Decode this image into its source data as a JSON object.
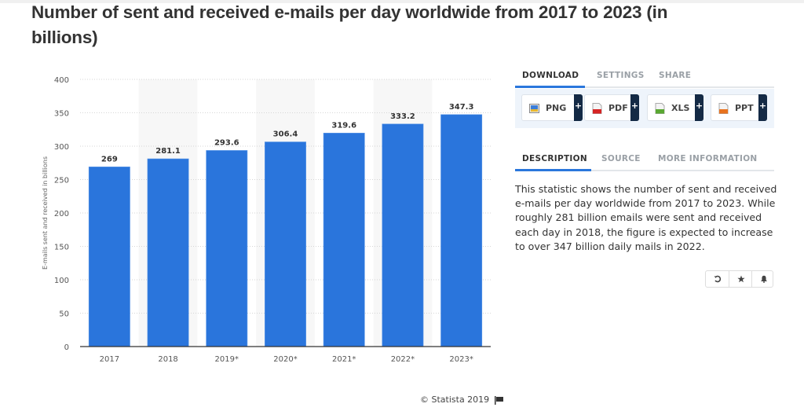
{
  "page": {
    "title": "Number of sent and received e-mails per day worldwide from 2017 to 2023 (in billions)",
    "credit": "© Statista 2019"
  },
  "panel": {
    "tabs_top": [
      {
        "label": "DOWNLOAD",
        "active": true
      },
      {
        "label": "SETTINGS",
        "active": false
      },
      {
        "label": "SHARE",
        "active": false
      }
    ],
    "downloads": [
      {
        "label": "PNG",
        "icon": "png-file-icon",
        "color": "#3b7dd8"
      },
      {
        "label": "PDF",
        "icon": "pdf-file-icon",
        "color": "#d62424"
      },
      {
        "label": "XLS",
        "icon": "xls-file-icon",
        "color": "#5aa832"
      },
      {
        "label": "PPT",
        "icon": "ppt-file-icon",
        "color": "#e8731f"
      }
    ],
    "plus_label": "+",
    "tabs_bottom": [
      {
        "label": "DESCRIPTION",
        "active": true
      },
      {
        "label": "SOURCE",
        "active": false
      },
      {
        "label": "MORE INFORMATION",
        "active": false
      }
    ],
    "description": "This statistic shows the number of sent and received e-mails per day worldwide from 2017 to 2023. While roughly 281 billion emails were sent and received each day in 2018, the figure is expected to increase to over 347 billion daily mails in 2022.",
    "actions": [
      "history-icon",
      "star-icon",
      "bell-icon"
    ]
  },
  "colors": {
    "bar": "#2a75dc",
    "accent": "#2a77dc",
    "band": "#f7f7f7"
  },
  "chart_data": {
    "type": "bar",
    "title": "Number of sent and received e-mails per day worldwide from 2017 to 2023 (in billions)",
    "xlabel": "",
    "ylabel": "E-mails sent and received in billions",
    "categories": [
      "2017",
      "2018",
      "2019*",
      "2020*",
      "2021*",
      "2022*",
      "2023*"
    ],
    "values": [
      269,
      281.1,
      293.6,
      306.4,
      319.6,
      333.2,
      347.3
    ],
    "data_labels": [
      "269",
      "281.1",
      "293.6",
      "306.4",
      "319.6",
      "333.2",
      "347.3"
    ],
    "ylim": [
      0,
      400
    ],
    "yticks": [
      0,
      50,
      100,
      150,
      200,
      250,
      300,
      350,
      400
    ],
    "grid": true,
    "legend": "none"
  }
}
